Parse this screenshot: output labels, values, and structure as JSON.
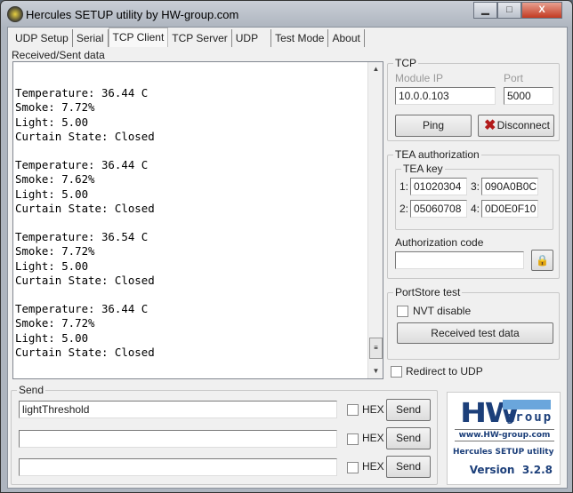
{
  "window": {
    "title": "Hercules SETUP utility by HW-group.com",
    "minimize": "▁",
    "maximize": "□",
    "close": "X"
  },
  "tabs": [
    "UDP Setup",
    "Serial",
    "TCP Client",
    "TCP Server",
    "UDP",
    "Test Mode",
    "About"
  ],
  "active_tab": "TCP Client",
  "received": {
    "label": "Received/Sent data",
    "text": "\nTemperature: 36.44 C\nSmoke: 7.72%\nLight: 5.00\nCurtain State: Closed\n\nTemperature: 36.44 C\nSmoke: 7.62%\nLight: 5.00\nCurtain State: Closed\n\nTemperature: 36.54 C\nSmoke: 7.72%\nLight: 5.00\nCurtain State: Closed\n\nTemperature: 36.44 C\nSmoke: 7.72%\nLight: 5.00\nCurtain State: Closed"
  },
  "tcp": {
    "label": "TCP",
    "module_ip_label": "Module IP",
    "module_ip": "10.0.0.103",
    "port_label": "Port",
    "port": "5000",
    "ping": "Ping",
    "disconnect": "Disconnect"
  },
  "tea": {
    "label": "TEA authorization",
    "key_label": "TEA key",
    "keys": [
      {
        "n": "1:",
        "v": "01020304"
      },
      {
        "n": "2:",
        "v": "05060708"
      },
      {
        "n": "3:",
        "v": "090A0B0C"
      },
      {
        "n": "4:",
        "v": "0D0E0F10"
      }
    ],
    "auth_label": "Authorization code",
    "auth_value": ""
  },
  "portstore": {
    "label": "PortStore test",
    "nvt": "NVT disable",
    "received_test": "Received test data"
  },
  "redirect": "Redirect to UDP",
  "send": {
    "label": "Send",
    "rows": [
      {
        "value": "lightThreshold",
        "hex": "HEX",
        "button": "Send"
      },
      {
        "value": "",
        "hex": "HEX",
        "button": "Send"
      },
      {
        "value": "",
        "hex": "HEX",
        "button": "Send"
      }
    ]
  },
  "logo": {
    "hw": "HW",
    "group": "group",
    "url": "www.HW-group.com",
    "product": "Hercules SETUP utility",
    "version": "Version  3.2.8"
  }
}
